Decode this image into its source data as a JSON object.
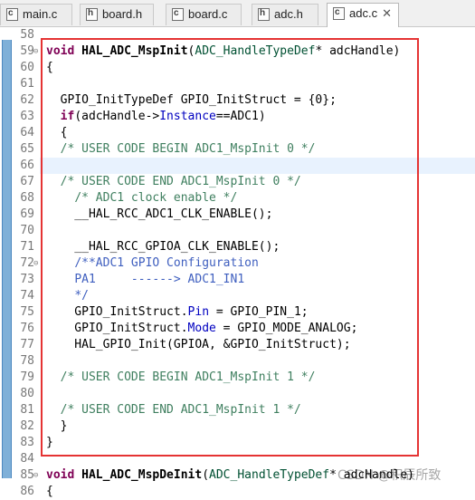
{
  "tabs": [
    {
      "icon": "c-file-icon",
      "glyph": "c",
      "label": "main.c",
      "active": false
    },
    {
      "icon": "h-file-icon",
      "glyph": "h",
      "label": "board.h",
      "active": false
    },
    {
      "icon": "c-file-icon",
      "glyph": "c",
      "label": "board.c",
      "active": false
    },
    {
      "icon": "h-file-icon",
      "glyph": "h",
      "label": "adc.h",
      "active": false
    },
    {
      "icon": "c-file-icon",
      "glyph": "c",
      "label": "adc.c",
      "active": true,
      "close": "✕"
    }
  ],
  "editor": {
    "lines": [
      {
        "n": "58",
        "fold": "",
        "html": ""
      },
      {
        "n": "59",
        "fold": "⊖",
        "html": "<span class=\"kw\">void</span> <span class=\"fn\">HAL_ADC_MspInit</span>(<span class=\"type\">ADC_HandleTypeDef</span>* adcHandle)"
      },
      {
        "n": "60",
        "fold": "",
        "html": "{"
      },
      {
        "n": "61",
        "fold": "",
        "html": ""
      },
      {
        "n": "62",
        "fold": "",
        "html": "  GPIO_InitTypeDef GPIO_InitStruct = {0};"
      },
      {
        "n": "63",
        "fold": "",
        "html": "  <span class=\"kw\">if</span>(adcHandle-><span class=\"field\">Instance</span>==ADC1)"
      },
      {
        "n": "64",
        "fold": "",
        "html": "  {"
      },
      {
        "n": "65",
        "fold": "",
        "html": "  <span class=\"comment\">/* USER CODE BEGIN ADC1_MspInit 0 */</span>"
      },
      {
        "n": "66",
        "fold": "",
        "html": "",
        "highlight": true
      },
      {
        "n": "67",
        "fold": "",
        "html": "  <span class=\"comment\">/* USER CODE END ADC1_MspInit 0 */</span>"
      },
      {
        "n": "68",
        "fold": "",
        "html": "    <span class=\"comment\">/* ADC1 clock enable */</span>"
      },
      {
        "n": "69",
        "fold": "",
        "html": "    __HAL_RCC_ADC1_CLK_ENABLE();"
      },
      {
        "n": "70",
        "fold": "",
        "html": ""
      },
      {
        "n": "71",
        "fold": "",
        "html": "    __HAL_RCC_GPIOA_CLK_ENABLE();"
      },
      {
        "n": "72",
        "fold": "⊖",
        "html": "    <span class=\"doccomment\">/**ADC1 GPIO Configuration</span>"
      },
      {
        "n": "73",
        "fold": "",
        "html": "    <span class=\"doccomment\">PA1     ------&gt; ADC1_IN1</span>"
      },
      {
        "n": "74",
        "fold": "",
        "html": "    <span class=\"doccomment\">*/</span>"
      },
      {
        "n": "75",
        "fold": "",
        "html": "    GPIO_InitStruct.<span class=\"field\">Pin</span> = GPIO_PIN_1;"
      },
      {
        "n": "76",
        "fold": "",
        "html": "    GPIO_InitStruct.<span class=\"field\">Mode</span> = GPIO_MODE_ANALOG;"
      },
      {
        "n": "77",
        "fold": "",
        "html": "    HAL_GPIO_Init(GPIOA, &amp;GPIO_InitStruct);"
      },
      {
        "n": "78",
        "fold": "",
        "html": ""
      },
      {
        "n": "79",
        "fold": "",
        "html": "  <span class=\"comment\">/* USER CODE BEGIN ADC1_MspInit 1 */</span>"
      },
      {
        "n": "80",
        "fold": "",
        "html": ""
      },
      {
        "n": "81",
        "fold": "",
        "html": "  <span class=\"comment\">/* USER CODE END ADC1_MspInit 1 */</span>"
      },
      {
        "n": "82",
        "fold": "",
        "html": "  }"
      },
      {
        "n": "83",
        "fold": "",
        "html": "}"
      },
      {
        "n": "84",
        "fold": "",
        "html": ""
      },
      {
        "n": "85",
        "fold": "⊖",
        "html": "<span class=\"kw\">void</span> <span class=\"fn\">HAL_ADC_MspDeInit</span>(<span class=\"type\">ADC_HandleTypeDef</span>* adcHandle)"
      },
      {
        "n": "86",
        "fold": "",
        "html": "{"
      }
    ]
  },
  "watermark": "CSDN @积辰所致"
}
